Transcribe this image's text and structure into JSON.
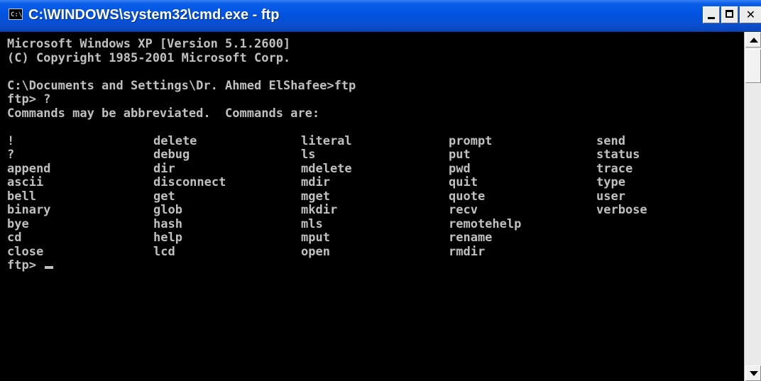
{
  "window": {
    "icon_text": "C:\\",
    "title": "C:\\WINDOWS\\system32\\cmd.exe - ftp"
  },
  "console": {
    "lines": [
      "Microsoft Windows XP [Version 5.1.2600]",
      "(C) Copyright 1985-2001 Microsoft Corp.",
      "",
      "C:\\Documents and Settings\\Dr. Ahmed ElShafee>ftp",
      "ftp> ?",
      "Commands may be abbreviated.  Commands are:",
      ""
    ],
    "command_columns": [
      [
        "!",
        "?",
        "append",
        "ascii",
        "bell",
        "binary",
        "bye",
        "cd",
        "close"
      ],
      [
        "delete",
        "debug",
        "dir",
        "disconnect",
        "get",
        "glob",
        "hash",
        "help",
        "lcd"
      ],
      [
        "literal",
        "ls",
        "mdelete",
        "mdir",
        "mget",
        "mkdir",
        "mls",
        "mput",
        "open"
      ],
      [
        "prompt",
        "put",
        "pwd",
        "quit",
        "quote",
        "recv",
        "remotehelp",
        "rename",
        "rmdir"
      ],
      [
        "send",
        "status",
        "trace",
        "type",
        "user",
        "verbose"
      ]
    ],
    "prompt": "ftp> "
  },
  "colors": {
    "console_background": "#000000",
    "console_text": "#c0c0c0",
    "titlebar": "#0053e1"
  }
}
